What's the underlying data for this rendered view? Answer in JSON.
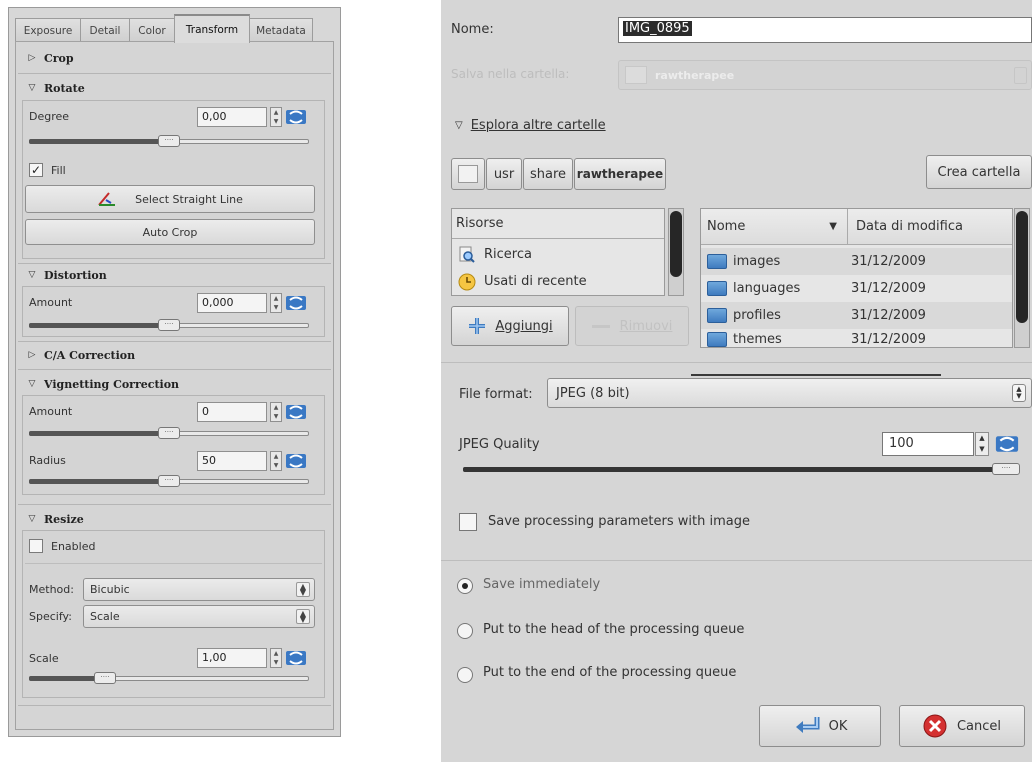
{
  "left": {
    "tabs": [
      "Exposure",
      "Detail",
      "Color",
      "Transform",
      "Metadata"
    ],
    "active_tab": "Transform",
    "crop": {
      "title": "Crop"
    },
    "rotate": {
      "title": "Rotate",
      "degree_label": "Degree",
      "degree_value": "0,00",
      "degree_level": 0.5,
      "fill_label": "Fill",
      "fill_checked": true,
      "select_line_label": "Select Straight Line",
      "auto_crop_label": "Auto Crop"
    },
    "distortion": {
      "title": "Distortion",
      "amount_label": "Amount",
      "amount_value": "0,000",
      "amount_level": 0.5
    },
    "ca": {
      "title": "C/A Correction"
    },
    "vignetting": {
      "title": "Vignetting Correction",
      "amount_label": "Amount",
      "amount_value": "0",
      "amount_level": 0.5,
      "radius_label": "Radius",
      "radius_value": "50",
      "radius_level": 0.5
    },
    "resize": {
      "title": "Resize",
      "enabled_label": "Enabled",
      "method_label": "Method:",
      "method_value": "Bicubic",
      "specify_label": "Specify:",
      "specify_value": "Scale",
      "scale_label": "Scale",
      "scale_value": "1,00",
      "scale_level": 0.25
    }
  },
  "dialog": {
    "name_label": "Nome:",
    "name_value": "IMG_0895",
    "save_in_label": "Salva nella cartella:",
    "save_in_value": "rawtherapee",
    "browse_label": "Esplora altre cartelle",
    "path_buttons": [
      "usr",
      "share",
      "rawtherapee"
    ],
    "create_folder_label": "Crea cartella",
    "places_header": "Risorse",
    "places": [
      "Ricerca",
      "Usati di recente"
    ],
    "add_label": "Aggiungi",
    "remove_label": "Rimuovi",
    "files_header_name": "Nome",
    "files_header_date": "Data di modifica",
    "files": [
      {
        "name": "images",
        "date": "31/12/2009"
      },
      {
        "name": "languages",
        "date": "31/12/2009"
      },
      {
        "name": "profiles",
        "date": "31/12/2009"
      },
      {
        "name": "themes",
        "date": "31/12/2009"
      }
    ],
    "file_format_label": "File format:",
    "file_format_value": "JPEG (8 bit)",
    "jpeg_quality_label": "JPEG Quality",
    "jpeg_quality_value": "100",
    "jpeg_quality_level": 1.0,
    "save_params_label": "Save processing parameters with image",
    "save_params_checked": false,
    "radio_options": [
      "Save immediately",
      "Put to the head of the processing queue",
      "Put to the end of the processing queue"
    ],
    "radio_selected": 0,
    "ok_label": "OK",
    "cancel_label": "Cancel"
  }
}
